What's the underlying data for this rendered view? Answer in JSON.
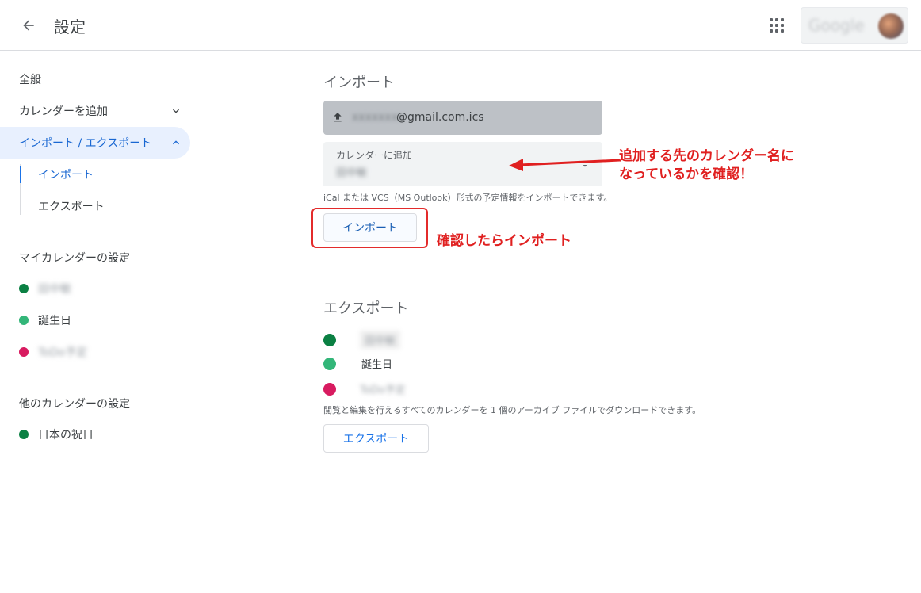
{
  "header": {
    "back_icon": "arrow-back-icon",
    "title": "設定",
    "apps_icon": "apps-grid-icon",
    "account_text": "Google"
  },
  "sidebar": {
    "general": "全般",
    "add_calendar": "カレンダーを追加",
    "import_export": "インポート / エクスポート",
    "sub_import": "インポート",
    "sub_export": "エクスポート",
    "my_calendars_heading": "マイカレンダーの設定",
    "my_calendars": [
      {
        "label": "田中敏",
        "color": "#0b8043",
        "blurred": true
      },
      {
        "label": "誕生日",
        "color": "#33b679",
        "blurred": false
      },
      {
        "label": "ToDo予定",
        "color": "#d81b60",
        "blurred": true
      }
    ],
    "other_calendars_heading": "他のカレンダーの設定",
    "other_calendars": [
      {
        "label": "日本の祝日",
        "color": "#0b8043"
      }
    ]
  },
  "import": {
    "title": "インポート",
    "file_name_blurred": "xxxxxxxx",
    "file_name_suffix": "@gmail.com.ics",
    "upload_icon": "upload-icon",
    "select_label": "カレンダーに追加",
    "select_value": "田中敏",
    "hint": "iCal または VCS（MS Outlook）形式の予定情報をインポートできます。",
    "button": "インポート"
  },
  "export": {
    "title": "エクスポート",
    "calendars": [
      {
        "label": "田中敏",
        "color": "#0b8043",
        "blurred": true
      },
      {
        "label": "誕生日",
        "color": "#33b679",
        "blurred": false
      },
      {
        "label": "ToDo予定",
        "color": "#d81b60",
        "blurred": true
      }
    ],
    "hint": "閲覧と編集を行えるすべてのカレンダーを 1 個のアーカイブ ファイルでダウンロードできます。",
    "button": "エクスポート"
  },
  "annotations": {
    "arrow_note_line1": "追加する先のカレンダー名に",
    "arrow_note_line2": "なっているかを確認！",
    "button_note": "確認したらインポート",
    "color": "#e02020"
  }
}
